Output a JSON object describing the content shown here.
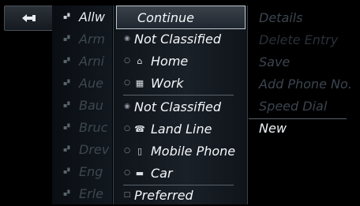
{
  "back_button": {
    "icon": "back-arrow-icon"
  },
  "contacts": [
    {
      "name": "Allw",
      "icon": "contact-card-icon"
    },
    {
      "name": "Arm",
      "icon": "contact-card-icon"
    },
    {
      "name": "Arni",
      "icon": "contact-card-icon"
    },
    {
      "name": "Aue",
      "icon": "contact-card-icon"
    },
    {
      "name": "Bau",
      "icon": "contact-card-icon"
    },
    {
      "name": "Bruc",
      "icon": "contact-card-icon"
    },
    {
      "name": "Drev",
      "icon": "contact-card-icon"
    },
    {
      "name": "Eng",
      "icon": "contact-card-icon"
    },
    {
      "name": "Erle",
      "icon": "contact-card-icon"
    }
  ],
  "options_menu": {
    "continue": "Continue",
    "category_group": [
      {
        "label": "Not Classified",
        "checked": true,
        "icon": ""
      },
      {
        "label": "Home",
        "checked": false,
        "icon": "home-icon"
      },
      {
        "label": "Work",
        "checked": false,
        "icon": "work-building-icon"
      }
    ],
    "type_group": [
      {
        "label": "Not Classified",
        "checked": true,
        "icon": ""
      },
      {
        "label": "Land Line",
        "checked": false,
        "icon": "landline-phone-icon"
      },
      {
        "label": "Mobile Phone",
        "checked": false,
        "icon": "mobile-phone-icon"
      },
      {
        "label": "Car",
        "checked": false,
        "icon": "car-icon"
      }
    ],
    "preferred": {
      "label": "Preferred",
      "checked": false
    }
  },
  "right_menu": {
    "details": "Details",
    "delete_entry": "Delete Entry",
    "save": "Save",
    "add_phone": "Add Phone No.",
    "speed_dial": "Speed Dial",
    "new": "New"
  },
  "colors": {
    "background": "#000000",
    "active_text": "#f0f4f7",
    "dim_text": "#3c4550"
  }
}
